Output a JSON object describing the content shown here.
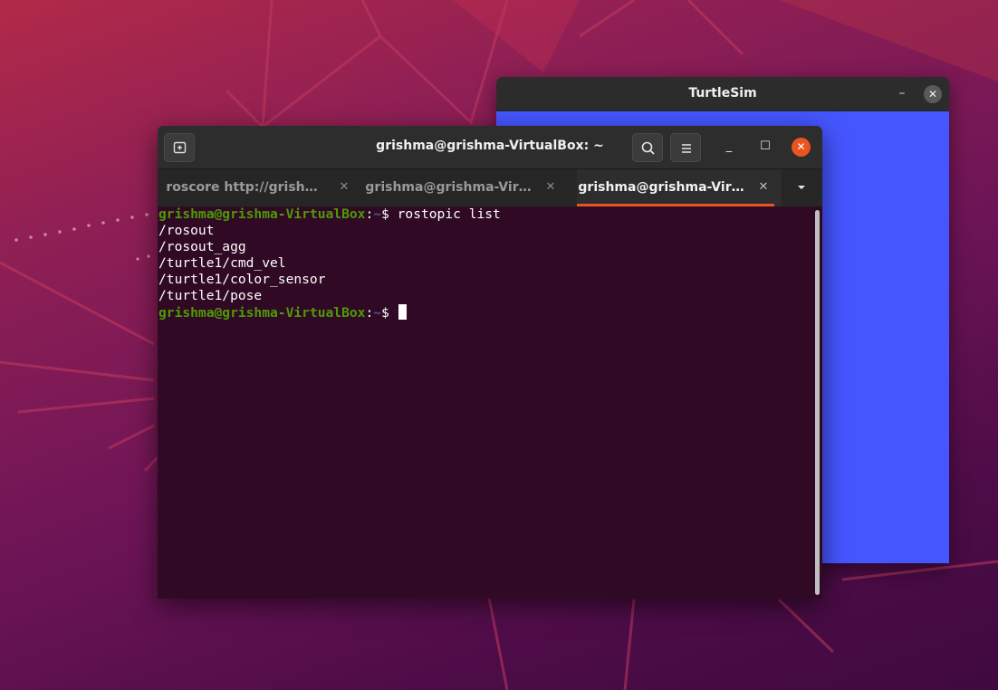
{
  "turtlesim": {
    "title": "TurtleSim",
    "minimize_glyph": "–",
    "close_glyph": "✕",
    "canvas_color": "#4556ff"
  },
  "terminal": {
    "title": "grishma@grishma-VirtualBox: ~",
    "buttons": {
      "new_tab_icon": "new-tab-icon",
      "search_icon": "search-icon",
      "menu_icon": "hamburger-menu-icon",
      "minimize_glyph": "_",
      "maximize_glyph": "☐",
      "close_glyph": "✕"
    },
    "tabs": [
      {
        "label": "roscore http://grish…",
        "close_glyph": "✕",
        "active": false
      },
      {
        "label": "grishma@grishma-Vir…",
        "close_glyph": "✕",
        "active": false
      },
      {
        "label": "grishma@grishma-Vir…",
        "close_glyph": "✕",
        "active": true
      }
    ],
    "accent_color": "#e95420",
    "lines": [
      {
        "user": "grishma@grishma-VirtualBox",
        "sep": ":",
        "path": "~",
        "sym": "$ ",
        "cmd": "rostopic list"
      },
      {
        "out": "/rosout"
      },
      {
        "out": "/rosout_agg"
      },
      {
        "out": "/turtle1/cmd_vel"
      },
      {
        "out": "/turtle1/color_sensor"
      },
      {
        "out": "/turtle1/pose"
      },
      {
        "user": "grishma@grishma-VirtualBox",
        "sep": ":",
        "path": "~",
        "sym": "$ ",
        "cmd": ""
      }
    ]
  }
}
